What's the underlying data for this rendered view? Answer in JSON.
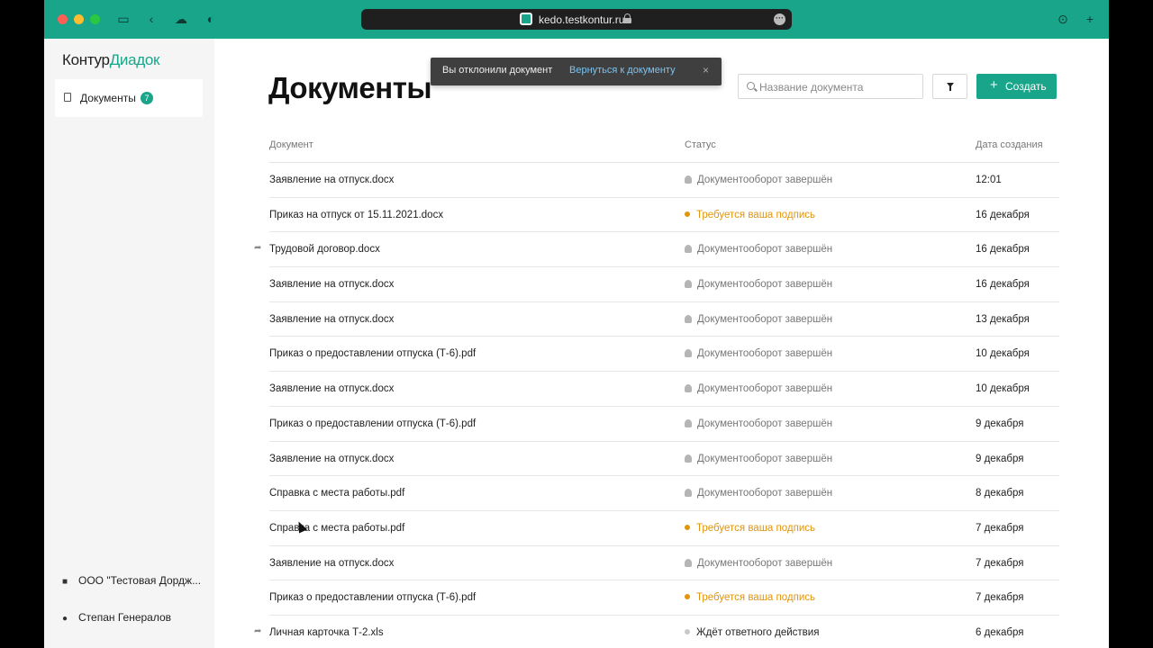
{
  "browser": {
    "url": "kedo.testkontur.ru",
    "accent": "#19a589"
  },
  "sidebar": {
    "logo_part1": "Контур",
    "logo_part2": "Диадок",
    "nav": [
      {
        "label": "Документы",
        "badge": "7",
        "icon": "document-icon"
      }
    ],
    "organization": "ООО \"Тестовая Дордж...",
    "user": "Степан Генералов"
  },
  "header": {
    "title": "Документы",
    "search_placeholder": "Название документа",
    "create_label": "Создать"
  },
  "toast": {
    "message": "Вы отклонили документ",
    "link": "Вернуться к документу",
    "close": "×"
  },
  "table": {
    "columns": [
      "Документ",
      "Статус",
      "Дата создания"
    ],
    "rows": [
      {
        "name": "Заявление на отпуск.docx",
        "status": "Документооборот завершён",
        "kind": "done",
        "date": "12:01",
        "arrow": false
      },
      {
        "name": "Приказ на отпуск от 15.11.2021.docx",
        "status": "Требуется ваша подпись",
        "kind": "sign",
        "date": "16 декабря",
        "arrow": false
      },
      {
        "name": "Трудовой договор.docx",
        "status": "Документооборот завершён",
        "kind": "done",
        "date": "16 декабря",
        "arrow": true
      },
      {
        "name": "Заявление на отпуск.docx",
        "status": "Документооборот завершён",
        "kind": "done",
        "date": "16 декабря",
        "arrow": false
      },
      {
        "name": "Заявление на отпуск.docx",
        "status": "Документооборот завершён",
        "kind": "done",
        "date": "13 декабря",
        "arrow": false
      },
      {
        "name": "Приказ о предоставлении отпуска (Т-6).pdf",
        "status": "Документооборот завершён",
        "kind": "done",
        "date": "10 декабря",
        "arrow": false
      },
      {
        "name": "Заявление на отпуск.docx",
        "status": "Документооборот завершён",
        "kind": "done",
        "date": "10 декабря",
        "arrow": false
      },
      {
        "name": "Приказ о предоставлении отпуска (Т-6).pdf",
        "status": "Документооборот завершён",
        "kind": "done",
        "date": "9 декабря",
        "arrow": false
      },
      {
        "name": "Заявление на отпуск.docx",
        "status": "Документооборот завершён",
        "kind": "done",
        "date": "9 декабря",
        "arrow": false
      },
      {
        "name": "Справка с места работы.pdf",
        "status": "Документооборот завершён",
        "kind": "done",
        "date": "8 декабря",
        "arrow": false
      },
      {
        "name": "Справка с места работы.pdf",
        "status": "Требуется ваша подпись",
        "kind": "sign",
        "date": "7 декабря",
        "arrow": false
      },
      {
        "name": "Заявление на отпуск.docx",
        "status": "Документооборот завершён",
        "kind": "done",
        "date": "7 декабря",
        "arrow": false
      },
      {
        "name": "Приказ о предоставлении отпуска (Т-6).pdf",
        "status": "Требуется ваша подпись",
        "kind": "sign",
        "date": "7 декабря",
        "arrow": false
      },
      {
        "name": "Личная карточка Т-2.xls",
        "status": "Ждёт ответного действия",
        "kind": "wait",
        "date": "6 декабря",
        "arrow": true
      }
    ]
  },
  "colors": {
    "sign": "#e0950a",
    "wait": "#c9c9c9"
  }
}
